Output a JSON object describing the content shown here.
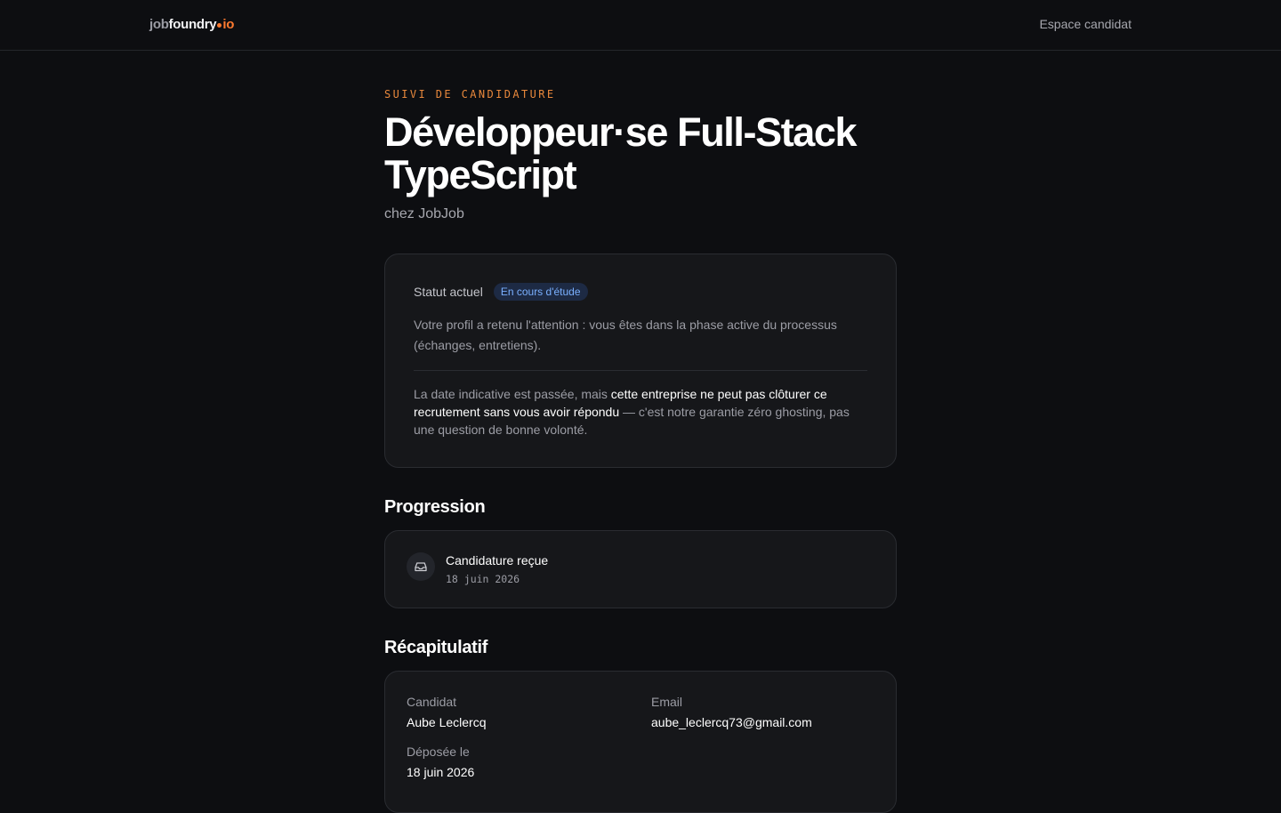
{
  "header": {
    "logo": {
      "part1": "job",
      "part2": "foundry",
      "part3": "io"
    },
    "nav_link": "Espace candidat"
  },
  "hero": {
    "eyebrow": "SUIVI DE CANDIDATURE",
    "title": "Développeur·se Full-Stack TypeScript",
    "company": "chez JobJob"
  },
  "status": {
    "label": "Statut actuel",
    "badge": "En cours d'étude",
    "description": "Votre profil a retenu l'attention : vous êtes dans la phase active du processus (échanges, entretiens).",
    "guarantee_pre": "La date indicative est passée, mais ",
    "guarantee_strong": "cette entreprise ne peut pas clôturer ce recrutement sans vous avoir répondu",
    "guarantee_post": " — c'est notre garantie zéro ghosting, pas une question de bonne volonté."
  },
  "progress": {
    "title": "Progression",
    "steps": [
      {
        "icon": "inbox-icon",
        "label": "Candidature reçue",
        "date": "18 juin 2026"
      }
    ]
  },
  "recap": {
    "title": "Récapitulatif",
    "candidate_label": "Candidat",
    "candidate_value": "Aube Leclercq",
    "email_label": "Email",
    "email_value": "aube_leclercq73@gmail.com",
    "submitted_label": "Déposée le",
    "submitted_value": "18 juin 2026"
  },
  "colors": {
    "accent": "#ff7a2f",
    "badge_bg": "#1d2a44",
    "badge_text": "#7ab0ff",
    "background": "#0d0e11",
    "card": "#16171a"
  }
}
